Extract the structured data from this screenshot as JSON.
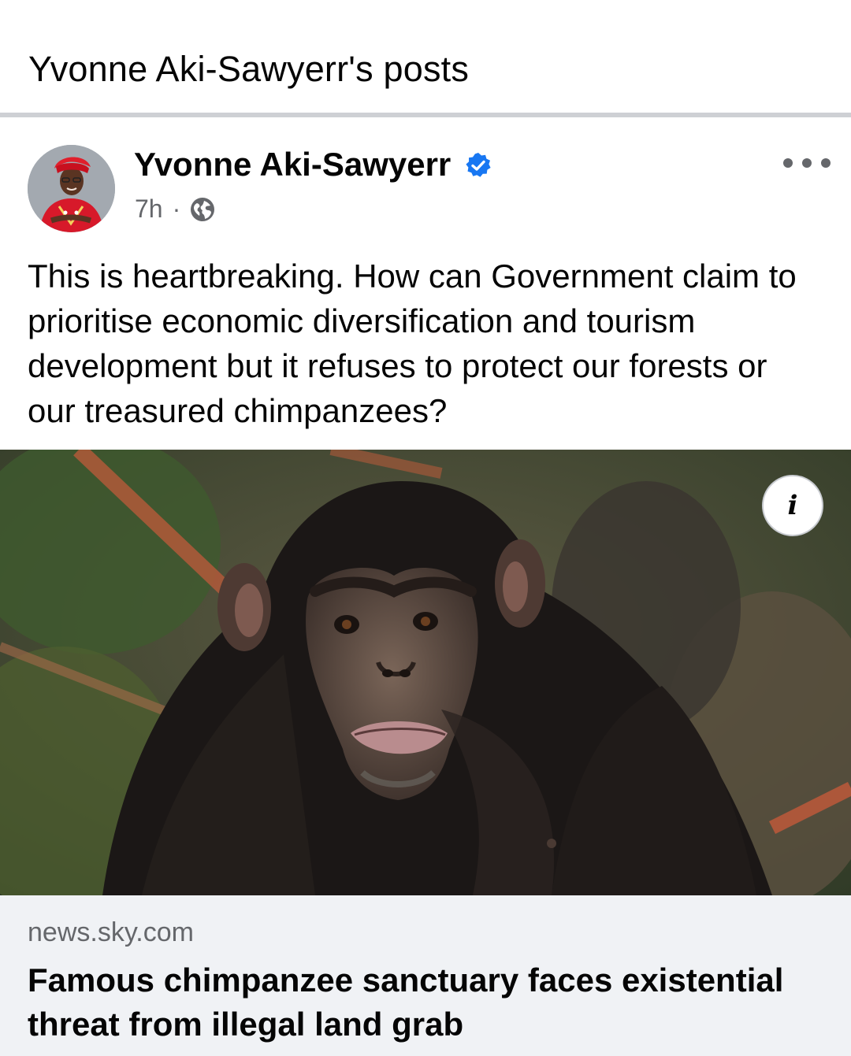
{
  "header": {
    "title": "Yvonne Aki-Sawyerr's posts"
  },
  "post": {
    "author": "Yvonne Aki-Sawyerr",
    "timestamp": "7h",
    "separator": "·",
    "privacy_icon": "globe-icon",
    "verified_icon": "verified-badge-icon",
    "more_icon": "more-options-icon",
    "text": "This is heartbreaking. How can Government claim to prioritise economic diversification and tourism development but it refuses to protect our forests or our treasured chimpanzees?"
  },
  "link": {
    "info_label": "i",
    "domain": "news.sky.com",
    "headline": "Famous chimpanzee sanctuary faces existential threat from illegal land grab"
  },
  "colors": {
    "verified_blue": "#1877f2",
    "secondary_text": "#65676b",
    "link_card_bg": "#f0f2f5",
    "separator": "#ced0d4"
  }
}
